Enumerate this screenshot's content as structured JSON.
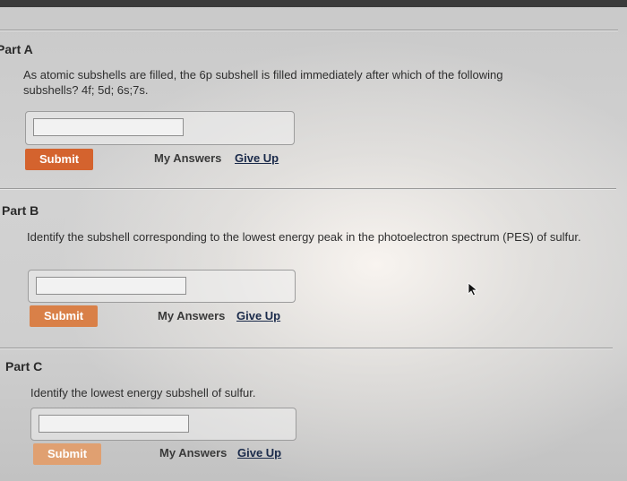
{
  "parts": [
    {
      "title": "Part A",
      "question": "As atomic subshells are filled, the 6p subshell is filled immediately after which of the following subshells? 4f; 5d; 6s;7s.",
      "answer_value": "",
      "submit_label": "Submit",
      "my_answers_label": "My Answers",
      "give_up_label": "Give Up"
    },
    {
      "title": "Part B",
      "question": "Identify the subshell corresponding to the lowest energy peak in the photoelectron spectrum (PES) of sulfur.",
      "answer_value": "",
      "submit_label": "Submit",
      "my_answers_label": "My Answers",
      "give_up_label": "Give Up"
    },
    {
      "title": "Part C",
      "question": "Identify the lowest energy subshell of sulfur.",
      "answer_value": "",
      "submit_label": "Submit",
      "my_answers_label": "My Answers",
      "give_up_label": "Give Up"
    }
  ],
  "colors": {
    "submit_active": "#d4632e",
    "submit_faded": "#e0a071",
    "link_give_up": "#1a2a4a"
  }
}
